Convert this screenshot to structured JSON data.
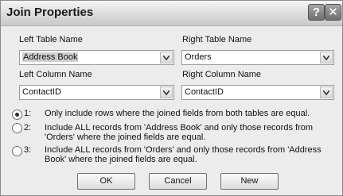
{
  "window": {
    "title": "Join Properties",
    "help_label": "?",
    "close_label": "✕"
  },
  "left_table": {
    "label": "Left Table Name",
    "value": "Address Book"
  },
  "right_table": {
    "label": "Right Table Name",
    "value": "Orders"
  },
  "left_column": {
    "label": "Left Column Name",
    "value": "ContactID"
  },
  "right_column": {
    "label": "Right Column Name",
    "value": "ContactID"
  },
  "options": [
    {
      "number": "1:",
      "text": "Only include rows where the joined fields from both tables are equal.",
      "selected": true
    },
    {
      "number": "2:",
      "line1": "Include ALL records from 'Address Book' and only those records from",
      "line2": "'Orders' where the joined fields are equal.",
      "selected": false
    },
    {
      "number": "3:",
      "line1": "Include ALL records from 'Orders' and only those records from 'Address",
      "line2": "Book' where the joined fields are equal.",
      "selected": false
    }
  ],
  "buttons": {
    "ok": "OK",
    "cancel": "Cancel",
    "new": "New"
  }
}
